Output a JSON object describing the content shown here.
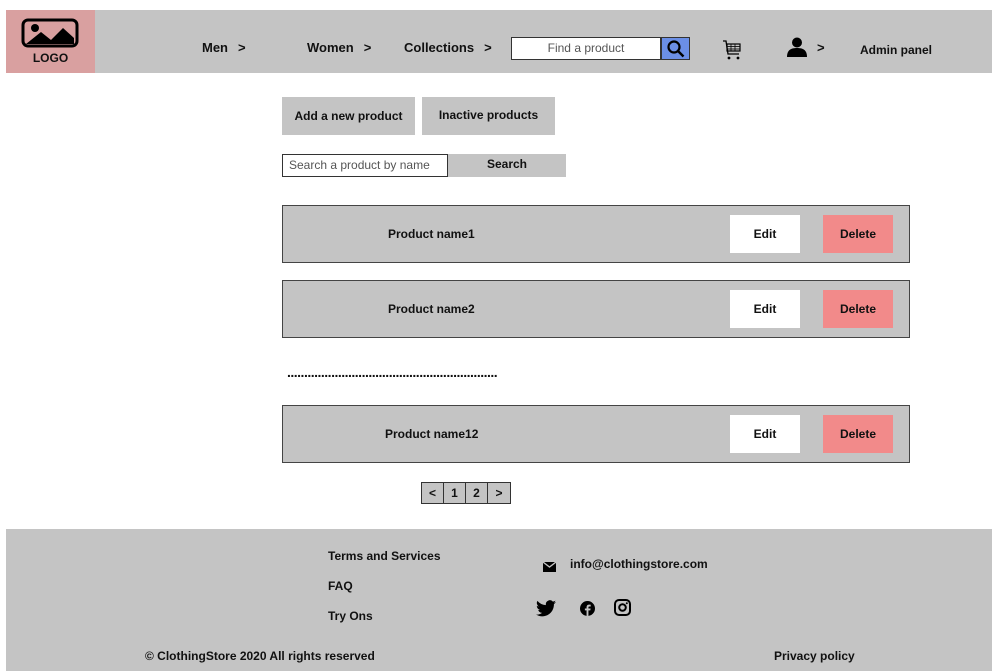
{
  "header": {
    "logo_text": "LOGO",
    "nav": [
      {
        "label": "Men",
        "chevron": ">"
      },
      {
        "label": "Women",
        "chevron": ">"
      },
      {
        "label": "Collections",
        "chevron": ">"
      }
    ],
    "search_placeholder": "Find a product",
    "search_icon": "search-icon",
    "cart_icon": "cart-icon",
    "user_icon": "user-icon",
    "user_chevron": ">",
    "admin_label": "Admin panel"
  },
  "actions": {
    "add_label": "Add a new product",
    "inactive_label": "Inactive products",
    "name_search_placeholder": "Search a product by name",
    "search_label": "Search"
  },
  "products": [
    {
      "name": "Product name1",
      "edit": "Edit",
      "delete": "Delete"
    },
    {
      "name": "Product name2",
      "edit": "Edit",
      "delete": "Delete"
    },
    {
      "name": "Product name12",
      "edit": "Edit",
      "delete": "Delete"
    }
  ],
  "ellipsis": "..............................................................",
  "pagination": {
    "prev": "<",
    "pages": [
      "1",
      "2"
    ],
    "next": ">"
  },
  "footer": {
    "links": [
      "Terms and Services",
      "FAQ",
      "Try Ons"
    ],
    "email": "info@clothingstore.com",
    "social": [
      "twitter-icon",
      "facebook-icon",
      "instagram-icon"
    ],
    "copyright": "© ClothingStore 2020 All rights reserved",
    "privacy": "Privacy policy"
  },
  "colors": {
    "panel": "#c4c4c4",
    "logo_bg": "#d9a0a0",
    "search_btn": "#6b8fe6",
    "delete_btn": "#f28a8a",
    "edit_btn": "#ffffff"
  }
}
